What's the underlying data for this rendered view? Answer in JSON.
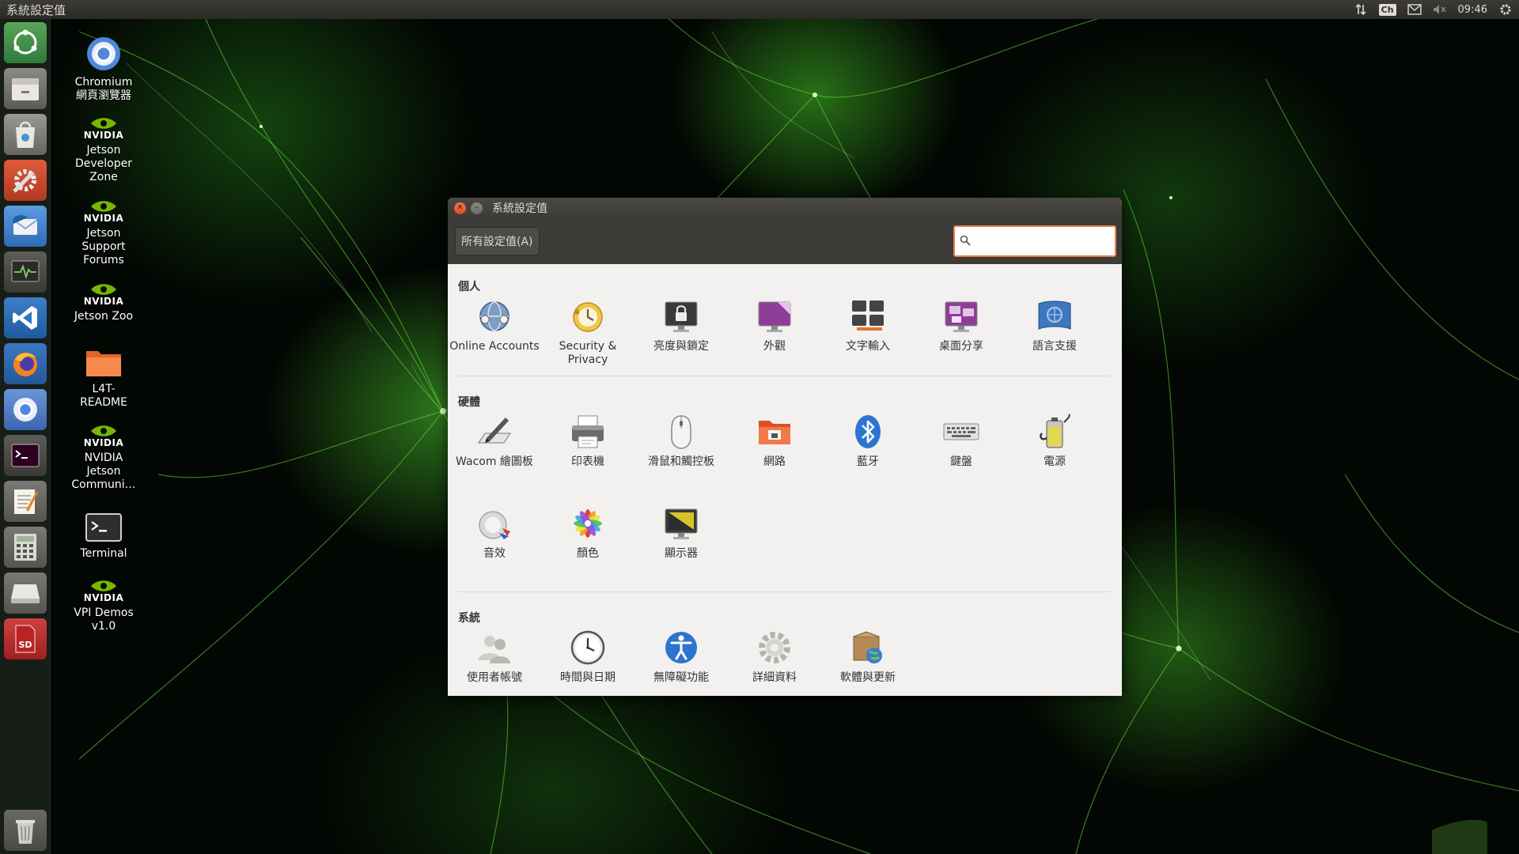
{
  "top_panel": {
    "title": "系統設定值",
    "keyboard_indicator": "Ch",
    "clock": "09:46"
  },
  "launcher": {
    "items": [
      {
        "name": "launcher-ubuntu-settings-icon"
      },
      {
        "name": "launcher-files-icon"
      },
      {
        "name": "launcher-software-icon"
      },
      {
        "name": "launcher-system-settings-icon"
      },
      {
        "name": "launcher-thunderbird-icon"
      },
      {
        "name": "launcher-system-monitor-icon"
      },
      {
        "name": "launcher-vscode-icon"
      },
      {
        "name": "launcher-firefox-icon"
      },
      {
        "name": "launcher-chromium-icon"
      },
      {
        "name": "launcher-terminal-icon"
      },
      {
        "name": "launcher-text-editor-icon"
      },
      {
        "name": "launcher-calculator-icon"
      },
      {
        "name": "launcher-drive-icon"
      },
      {
        "name": "launcher-sd-card-icon"
      },
      {
        "name": "launcher-trash-icon"
      }
    ]
  },
  "desktop_icons": {
    "chromium": [
      "Chromium",
      "網頁瀏覽器"
    ],
    "dev_zone": [
      "Jetson",
      "Developer",
      "Zone"
    ],
    "forums": [
      "Jetson",
      "Support",
      "Forums"
    ],
    "zoo": [
      "Jetson Zoo"
    ],
    "readme": [
      "L4T-",
      "README"
    ],
    "community": [
      "NVIDIA",
      "Jetson",
      "Communi…"
    ],
    "terminal": [
      "Terminal"
    ],
    "vpi": [
      "VPI Demos",
      "v1.0"
    ],
    "nvidia_wordmark": "NVIDIA"
  },
  "window": {
    "title": "系統設定值",
    "all_settings_button": "所有設定值(A)",
    "search": {
      "value": "",
      "placeholder": ""
    },
    "sections": {
      "personal": {
        "title": "個人",
        "items": [
          {
            "label": "Online Accounts",
            "icon": "online-accounts-icon"
          },
          {
            "label": "Security & Privacy",
            "icon": "security-privacy-icon"
          },
          {
            "label": "亮度與鎖定",
            "icon": "brightness-lock-icon"
          },
          {
            "label": "外觀",
            "icon": "appearance-icon"
          },
          {
            "label": "文字輸入",
            "icon": "text-entry-icon"
          },
          {
            "label": "桌面分享",
            "icon": "desktop-sharing-icon"
          },
          {
            "label": "語言支援",
            "icon": "language-support-icon"
          }
        ]
      },
      "hardware": {
        "title": "硬體",
        "items": [
          {
            "label": "Wacom 繪圖板",
            "icon": "wacom-tablet-icon"
          },
          {
            "label": "印表機",
            "icon": "printer-icon"
          },
          {
            "label": "滑鼠和觸控板",
            "icon": "mouse-touchpad-icon"
          },
          {
            "label": "網路",
            "icon": "network-icon"
          },
          {
            "label": "藍牙",
            "icon": "bluetooth-icon"
          },
          {
            "label": "鍵盤",
            "icon": "keyboard-icon"
          },
          {
            "label": "電源",
            "icon": "power-icon"
          },
          {
            "label": "音效",
            "icon": "sound-icon"
          },
          {
            "label": "顏色",
            "icon": "color-icon"
          },
          {
            "label": "顯示器",
            "icon": "display-icon"
          }
        ]
      },
      "system": {
        "title": "系統",
        "items": [
          {
            "label": "使用者帳號",
            "icon": "user-accounts-icon"
          },
          {
            "label": "時間與日期",
            "icon": "time-date-icon"
          },
          {
            "label": "無障礙功能",
            "icon": "accessibility-icon"
          },
          {
            "label": "詳細資料",
            "icon": "details-icon"
          },
          {
            "label": "軟體與更新",
            "icon": "software-updates-icon"
          }
        ]
      }
    }
  },
  "colors": {
    "accent_orange": "#e9804a",
    "panel_dark": "#3c3b37",
    "window_bg": "#f2f1f0",
    "wallpaper_green": "#4ccf2a"
  }
}
